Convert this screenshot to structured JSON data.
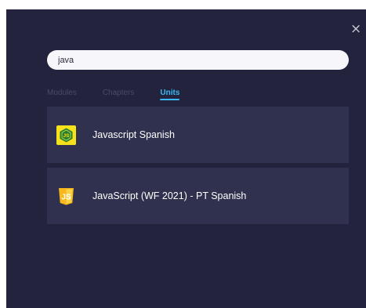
{
  "search": {
    "value": "java"
  },
  "tabs": [
    {
      "label": "Modules",
      "active": false
    },
    {
      "label": "Chapters",
      "active": false
    },
    {
      "label": "Units",
      "active": true
    }
  ],
  "results": [
    {
      "title": "Javascript Spanish",
      "icon": "nodejs-icon"
    },
    {
      "title": "JavaScript (WF 2021) - PT Spanish",
      "icon": "javascript-shield-icon"
    }
  ],
  "close": {
    "glyph": "×"
  }
}
